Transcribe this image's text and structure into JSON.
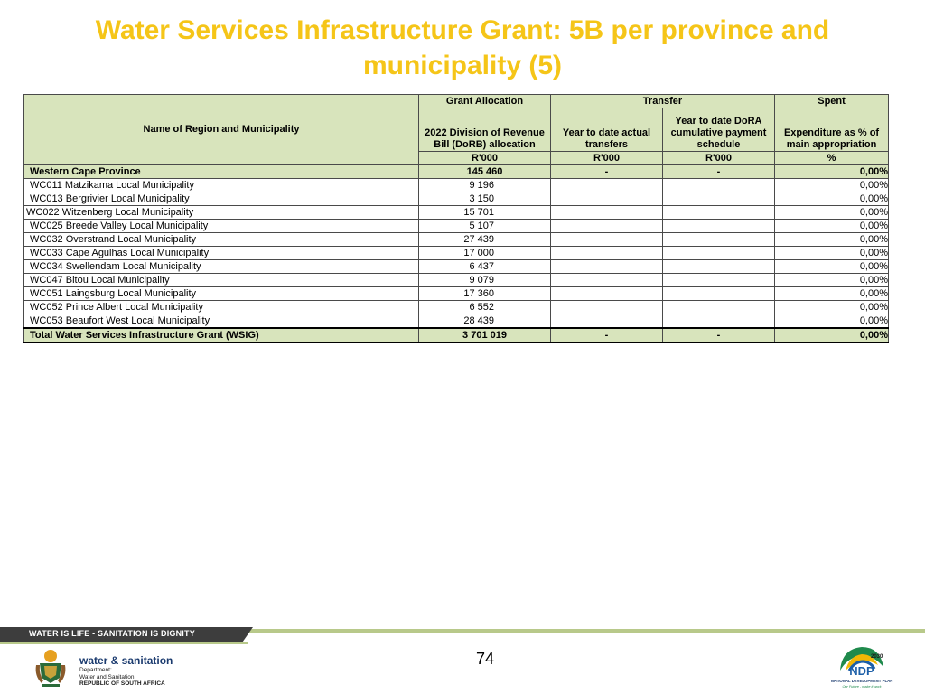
{
  "title": "Water Services Infrastructure Grant: 5B per province and municipality (5)",
  "table": {
    "headers": {
      "name": "Name of Region and Municipality",
      "grant_allocation": "Grant Allocation",
      "transfer": "Transfer",
      "spent": "Spent",
      "dorb": "2022 Division of Revenue Bill (DoRB) allocation",
      "ytd_actual": "Year to date actual transfers",
      "ytd_dora": "Year to date DoRA cumulative payment schedule",
      "expenditure": "Expenditure as % of main appropriation",
      "unit_1": "R'000",
      "unit_2": "R'000",
      "unit_3": "R'000",
      "unit_4": "%"
    },
    "province_row": {
      "name": "Western Cape Province",
      "allocation": "145 460",
      "ytd_actual": "-",
      "ytd_dora": "-",
      "pct": "0,00%"
    },
    "rows": [
      {
        "name": "WC011 Matzikama Local Municipality",
        "allocation": "9 196",
        "pct": "0,00%"
      },
      {
        "name": "WC013 Bergrivier Local Municipality",
        "allocation": "3 150",
        "pct": "0,00%"
      },
      {
        "name": "WC022 Witzenberg Local Municipality",
        "allocation": "15 701",
        "pct": "0,00%"
      },
      {
        "name": "WC025 Breede Valley Local Municipality",
        "allocation": "5 107",
        "pct": "0,00%"
      },
      {
        "name": "WC032 Overstrand Local Municipality",
        "allocation": "27 439",
        "pct": "0,00%"
      },
      {
        "name": "WC033 Cape Agulhas Local Municipality",
        "allocation": "17 000",
        "pct": "0,00%"
      },
      {
        "name": "WC034 Swellendam Local Municipality",
        "allocation": "6 437",
        "pct": "0,00%"
      },
      {
        "name": "WC047 Bitou Local Municipality",
        "allocation": "9 079",
        "pct": "0,00%"
      },
      {
        "name": "WC051 Laingsburg Local Municipality",
        "allocation": "17 360",
        "pct": "0,00%"
      },
      {
        "name": "WC052 Prince Albert Local Municipality",
        "allocation": "6 552",
        "pct": "0,00%"
      },
      {
        "name": "WC053 Beaufort West Local Municipality",
        "allocation": "28 439",
        "pct": "0,00%"
      }
    ],
    "total_row": {
      "name": "Total Water Services Infrastructure Grant (WSIG)",
      "allocation": "3 701 019",
      "ytd_actual": "-",
      "ytd_dora": "-",
      "pct": "0,00%"
    }
  },
  "footer": {
    "slogan": "WATER IS LIFE - SANITATION IS DIGNITY",
    "page_number": "74",
    "dept_name": "water & sanitation",
    "dept_line1": "Department:",
    "dept_line2": "Water and Sanitation",
    "dept_line3": "REPUBLIC OF SOUTH AFRICA",
    "ndp_name": "NATIONAL DEVELOPMENT PLAN",
    "ndp_tagline": "Our Future - make it work",
    "ndp_year": "2030",
    "ndp_abbr": "NDP"
  },
  "colors": {
    "title": "#f5c518",
    "header_fill": "#d8e4bc",
    "footer_dark": "#3d3d3d",
    "footer_accent": "#b8c98a"
  }
}
